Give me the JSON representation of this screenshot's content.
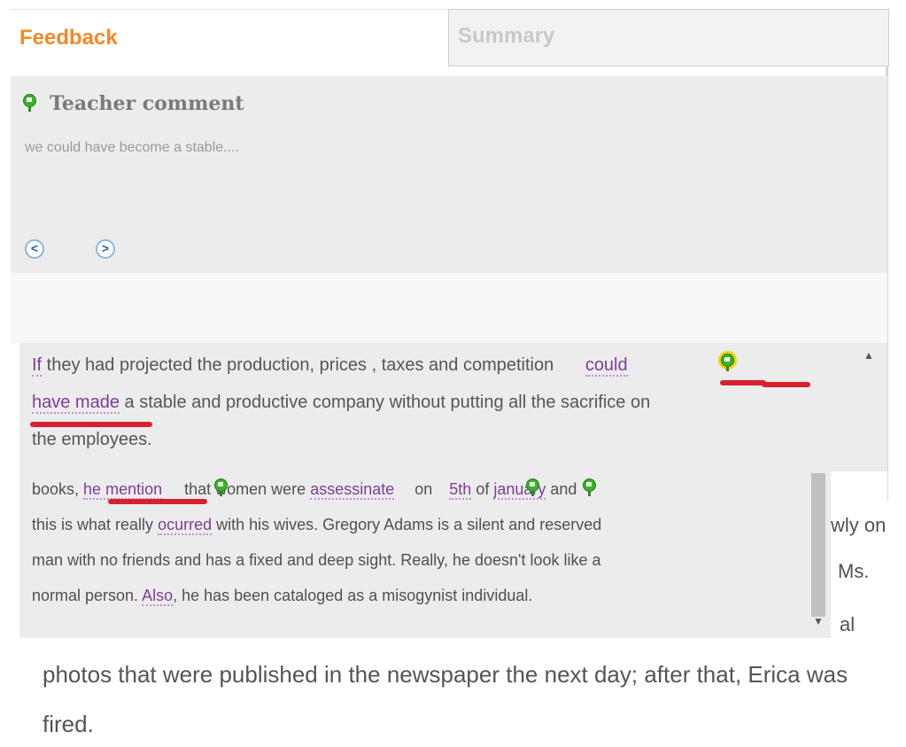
{
  "tabs": {
    "feedback": "Feedback",
    "summary": "Summary"
  },
  "comment": {
    "title": "Teacher comment",
    "text": "we could have become a stable....",
    "prev_icon": "<",
    "next_icon": ">"
  },
  "essay1": {
    "l1_if": "If",
    "l1_rest": " they had projected the production, prices , taxes and competition ",
    "l1_could": "could",
    "l2_have_made": "have made",
    "l2_rest": " a stable and productive company without putting all the sacrifice on",
    "l3": "the employees."
  },
  "essay2": {
    "l1_books": "books, ",
    "l1_he_mention": "he mention",
    "l1_that": " that women were ",
    "l1_assessinate": "assessinate",
    "l1_on": " on ",
    "l1_5th": "5th",
    "l1_of": " of ",
    "l1_january": "january",
    "l1_and": " and",
    "l2_a": "this is what really ",
    "l2_ocurred": "ocurred",
    "l2_b": " with his wives. Gregory Adams is a silent and reserved",
    "l3": "man with no friends and has a fixed and deep sight. Really, he doesn't look like a",
    "l4_a": "normal person. ",
    "l4_also": "Also",
    "l4_b": ", he has been cataloged as a misogynist individual."
  },
  "partials": {
    "p1": "wly on",
    "p2": "Ms.",
    "p3": "al"
  },
  "bottom": {
    "line1": "photos that were published in the newspaper the next day; after that, Erica was",
    "line2": "fired."
  },
  "colors": {
    "accent": "#f08a24",
    "annotation_red": "#d7212e",
    "link_purple": "#7d3e95"
  }
}
